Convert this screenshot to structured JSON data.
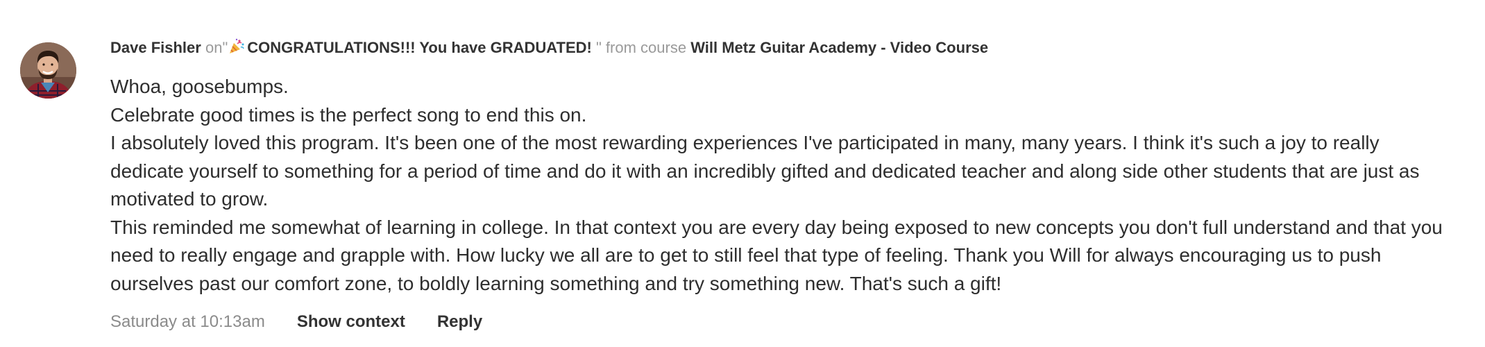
{
  "comment": {
    "author": "Dave Fishler",
    "connector_on": "on",
    "quote_open": "\"",
    "post_title": "CONGRATULATIONS!!! You have GRADUATED! ",
    "quote_close_from": "\" from course",
    "course_name": "Will Metz Guitar Academy - Video Course",
    "avatar_icon": "person-avatar",
    "title_icon": "party-popper-icon",
    "paragraphs": [
      "Whoa, goosebumps.",
      "Celebrate good times is the perfect song to end this on.",
      "I absolutely loved this program. It's been one of the most rewarding experiences I've participated in many, many years. I think it's such a joy to really dedicate yourself to something for a period of time and do it with an incredibly gifted and dedicated teacher and along side other students that are just as motivated to grow.",
      "This reminded me somewhat of learning in college. In that context you are every day being exposed to new concepts you don't full understand and that you need to really engage and grapple with. How lucky we all are to get to still feel that type of feeling. Thank you Will for always encouraging us to push ourselves past our comfort zone, to boldly learning something and try something new. That's such a gift!"
    ],
    "timestamp": "Saturday at 10:13am",
    "show_context_label": "Show context",
    "reply_label": "Reply"
  },
  "colors": {
    "text": "#2e2e2e",
    "muted": "#9a9a9a",
    "timestamp": "#8b8b8b"
  }
}
